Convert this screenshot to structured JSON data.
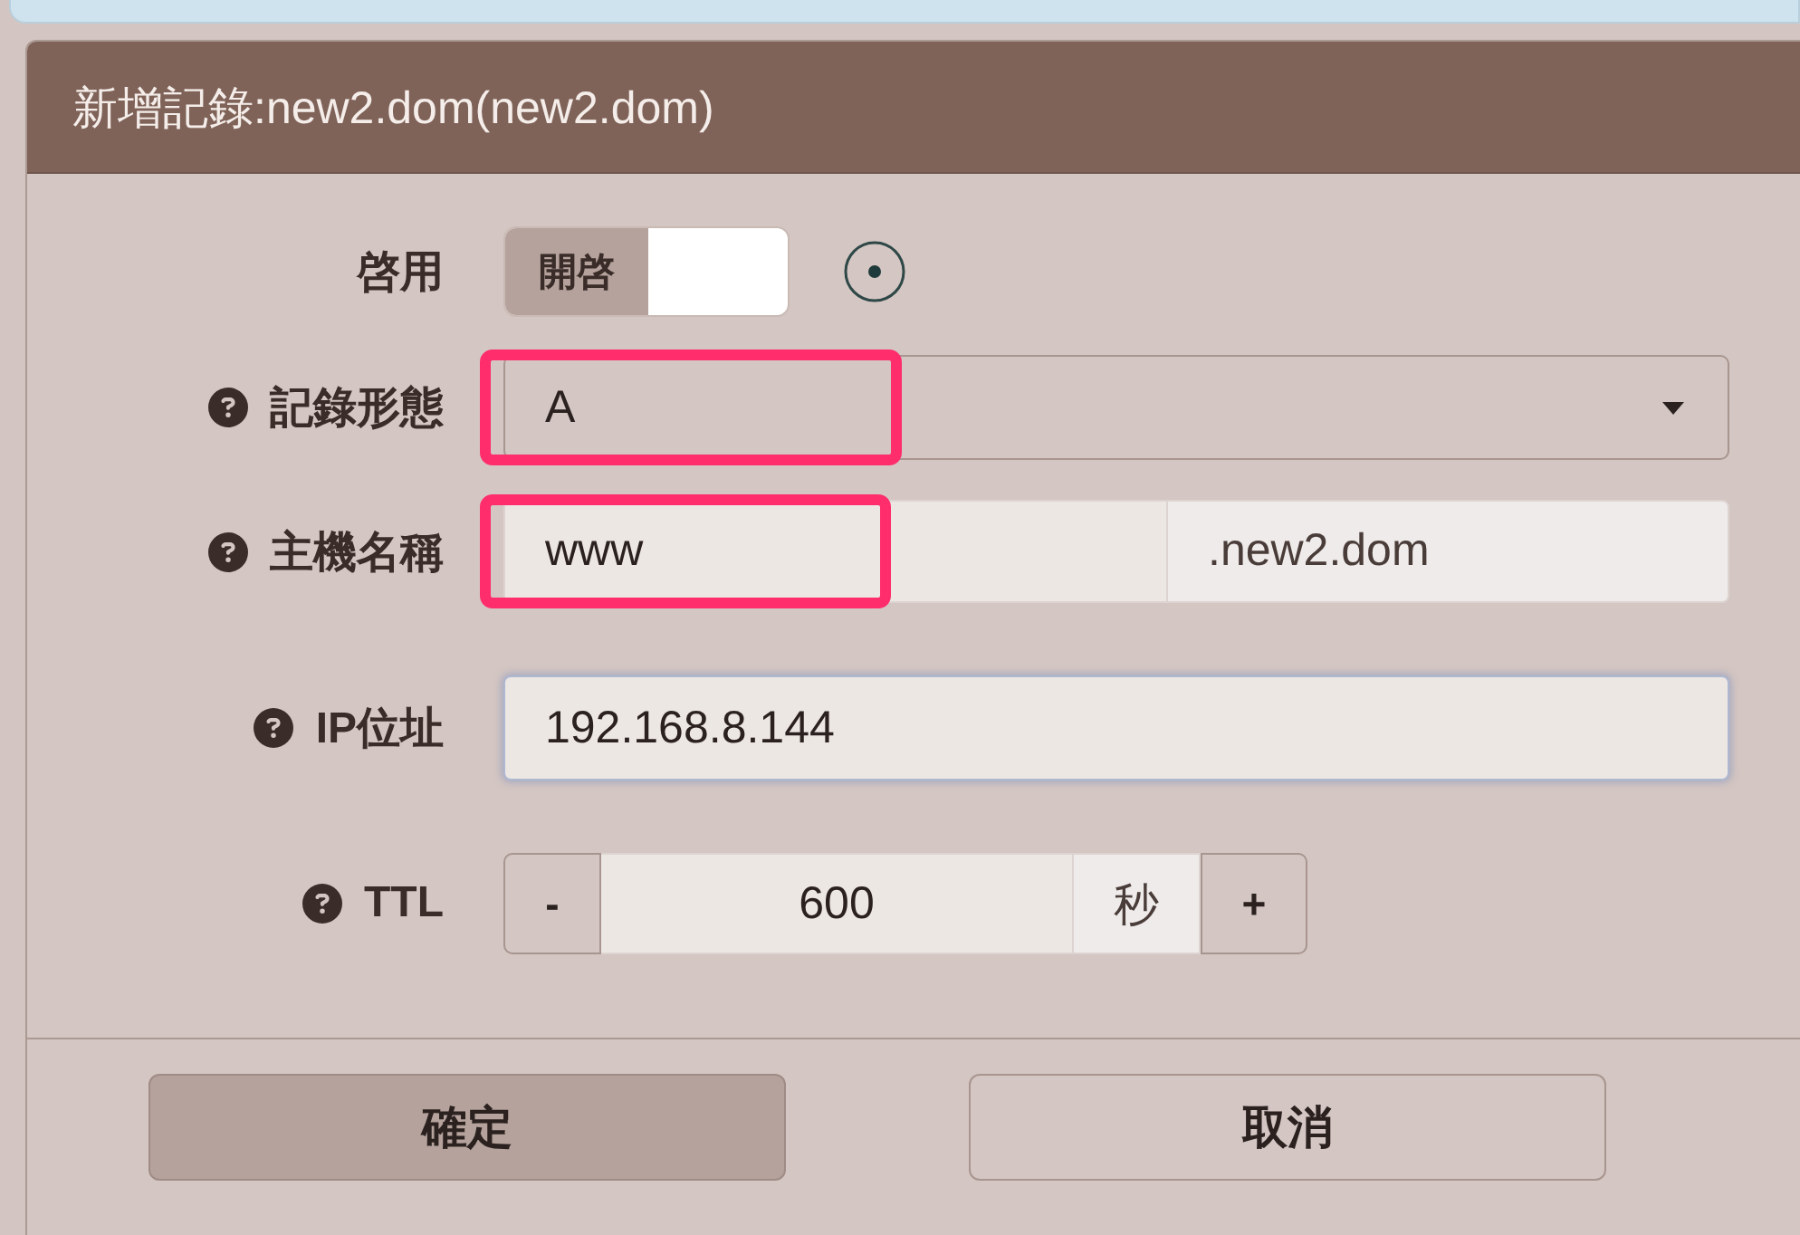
{
  "dialog": {
    "title": "新增記錄:new2.dom(new2.dom)"
  },
  "fields": [
    {
      "kind": "toggle",
      "label": "啓用",
      "help": false,
      "toggle_label": "開啓",
      "on": true
    },
    {
      "kind": "select",
      "label": "記錄形態",
      "help": true,
      "value": "A",
      "highlighted": true
    },
    {
      "kind": "domain",
      "label": "主機名稱",
      "help": true,
      "value": "www",
      "suffix": ".new2.dom",
      "highlighted": true
    },
    {
      "kind": "text",
      "label": "IP位址",
      "help": true,
      "value": "192.168.8.144",
      "focused": true
    },
    {
      "kind": "stepper",
      "label": "TTL",
      "help": true,
      "decrement": "-",
      "value": "600",
      "unit": "秒",
      "increment": "+"
    }
  ],
  "buttons": [
    {
      "label": "確定",
      "primary": true
    },
    {
      "label": "取消",
      "primary": false
    }
  ]
}
